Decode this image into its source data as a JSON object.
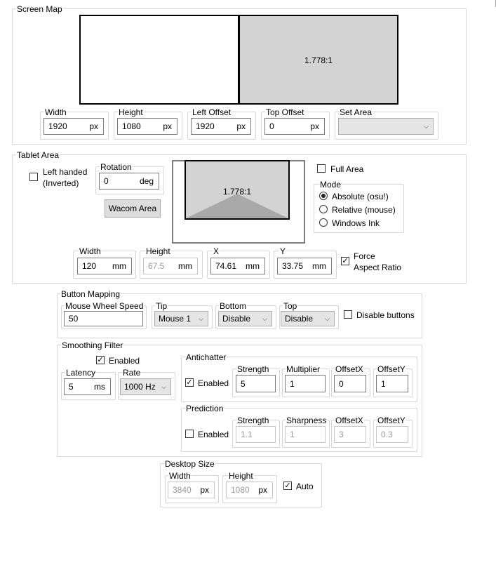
{
  "screen_map": {
    "title": "Screen Map",
    "ratio_label": "1.778:1",
    "width": {
      "label": "Width",
      "value": "1920",
      "unit": "px"
    },
    "height": {
      "label": "Height",
      "value": "1080",
      "unit": "px"
    },
    "left_offset": {
      "label": "Left Offset",
      "value": "1920",
      "unit": "px"
    },
    "top_offset": {
      "label": "Top Offset",
      "value": "0",
      "unit": "px"
    },
    "set_area": {
      "label": "Set Area",
      "value": ""
    }
  },
  "tablet_area": {
    "title": "Tablet Area",
    "left_handed_label": "Left handed\n(Inverted)",
    "left_handed_line1": "Left handed",
    "left_handed_line2": "(Inverted)",
    "left_handed_checked": false,
    "rotation": {
      "label": "Rotation",
      "value": "0",
      "unit": "deg"
    },
    "wacom_button": "Wacom Area",
    "ratio_label": "1.778:1",
    "full_area_label": "Full Area",
    "mode": {
      "title": "Mode",
      "options": [
        "Absolute (osu!)",
        "Relative (mouse)",
        "Windows Ink"
      ],
      "selected": "Absolute (osu!)"
    },
    "width": {
      "label": "Width",
      "value": "120",
      "unit": "mm"
    },
    "height": {
      "label": "Height",
      "value": "67.5",
      "unit": "mm"
    },
    "x": {
      "label": "X",
      "value": "74.61",
      "unit": "mm"
    },
    "y": {
      "label": "Y",
      "value": "33.75",
      "unit": "mm"
    },
    "force_aspect_line1": "Force",
    "force_aspect_line2": "Aspect Ratio",
    "force_aspect_checked": true
  },
  "button_mapping": {
    "title": "Button Mapping",
    "wheel_speed": {
      "label": "Mouse Wheel Speed",
      "value": "50"
    },
    "tip": {
      "label": "Tip",
      "value": "Mouse 1"
    },
    "bottom": {
      "label": "Bottom",
      "value": "Disable"
    },
    "top": {
      "label": "Top",
      "value": "Disable"
    },
    "disable_buttons_label": "Disable buttons",
    "disable_buttons_checked": false
  },
  "smoothing": {
    "title": "Smoothing Filter",
    "enabled_label": "Enabled",
    "enabled_checked": true,
    "latency": {
      "label": "Latency",
      "value": "5",
      "unit": "ms"
    },
    "rate": {
      "label": "Rate",
      "value": "1000 Hz"
    },
    "antichatter": {
      "title": "Antichatter",
      "enabled_label": "Enabled",
      "enabled_checked": true,
      "strength": {
        "label": "Strength",
        "value": "5"
      },
      "multiplier": {
        "label": "Multiplier",
        "value": "1"
      },
      "offset_x": {
        "label": "OffsetX",
        "value": "0"
      },
      "offset_y": {
        "label": "OffsetY",
        "value": "1"
      }
    },
    "prediction": {
      "title": "Prediction",
      "enabled_label": "Enabled",
      "enabled_checked": false,
      "strength": {
        "label": "Strength",
        "value": "1.1"
      },
      "sharpness": {
        "label": "Sharpness",
        "value": "1"
      },
      "offset_x": {
        "label": "OffsetX",
        "value": "3"
      },
      "offset_y": {
        "label": "OffsetY",
        "value": "0.3"
      }
    }
  },
  "desktop_size": {
    "title": "Desktop Size",
    "width": {
      "label": "Width",
      "value": "3840",
      "unit": "px"
    },
    "height": {
      "label": "Height",
      "value": "1080",
      "unit": "px"
    },
    "auto_label": "Auto",
    "auto_checked": true
  },
  "glyphs": {
    "check": "✓",
    "dropdown": "⌄",
    "dropdown_small": "⌵"
  },
  "colors": {
    "area_fill": "#d3d3d3",
    "area_border": "#000000",
    "wedge": "#a9a9a9"
  }
}
